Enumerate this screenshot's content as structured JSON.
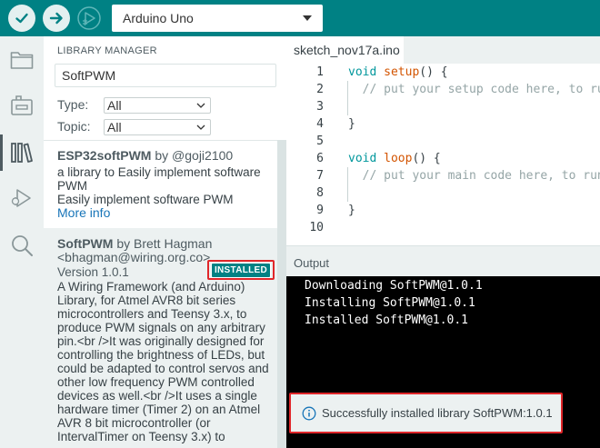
{
  "toolbar": {
    "verify_icon": "check-icon",
    "upload_icon": "arrow-right-icon",
    "debug_icon": "debug-icon",
    "board": "Arduino Uno",
    "colors": {
      "toolbar_bg": "#008184",
      "accent": "#00979c"
    }
  },
  "activitybar": {
    "items": [
      "folder-icon",
      "boards-icon",
      "library-icon",
      "debug-icon",
      "search-icon"
    ],
    "active": "library-icon"
  },
  "library": {
    "title": "LIBRARY MANAGER",
    "search_value": "SoftPWM",
    "type_label": "Type:",
    "type_value": "All",
    "topic_label": "Topic:",
    "topic_value": "All",
    "items": [
      {
        "name": "ESP32softPWM",
        "by": " by @goji2100",
        "description_lines": [
          "a library to Easily implement software",
          "PWM",
          "Easily implement software PWM"
        ],
        "more_info": "More info"
      },
      {
        "name": "SoftPWM",
        "by": " by Brett Hagman",
        "author_email": "<bhagman@wiring.org.co>",
        "version": "Version 1.0.1",
        "badge": "INSTALLED",
        "description_lines": [
          "A Wiring Framework (and Arduino)",
          "Library, for Atmel AVR8 bit series",
          "microcontrollers and Teensy 3.x, to",
          "produce PWM signals on any arbitrary",
          "pin.<br />It was originally designed for",
          "controlling the brightness of LEDs, but",
          "could be adapted to control servos and",
          "other low frequency PWM controlled",
          "devices as well.<br />It uses a single",
          "hardware timer (Timer 2) on an Atmel",
          "AVR 8 bit microcontroller (or",
          "IntervalTimer on Teensy 3.x) to"
        ]
      }
    ]
  },
  "editor": {
    "tab": "sketch_nov17a.ino",
    "lines": [
      {
        "n": "1",
        "kw": "void ",
        "fn": "setup",
        "rest": "() {"
      },
      {
        "n": "2",
        "comment": "  // put your setup code here, to run once:"
      },
      {
        "n": "3"
      },
      {
        "n": "4",
        "rest": "}"
      },
      {
        "n": "5"
      },
      {
        "n": "6",
        "kw": "void ",
        "fn": "loop",
        "rest": "() {"
      },
      {
        "n": "7",
        "comment": "  // put your main code here, to run repeatedly:"
      },
      {
        "n": "8"
      },
      {
        "n": "9",
        "rest": "}"
      },
      {
        "n": "10"
      }
    ]
  },
  "output": {
    "title": "Output",
    "lines": [
      "Downloading SoftPWM@1.0.1",
      "Installing SoftPWM@1.0.1",
      "Installed SoftPWM@1.0.1"
    ],
    "toast_icon": "info-icon",
    "toast": "Successfully installed library SoftPWM:1.0.1"
  }
}
